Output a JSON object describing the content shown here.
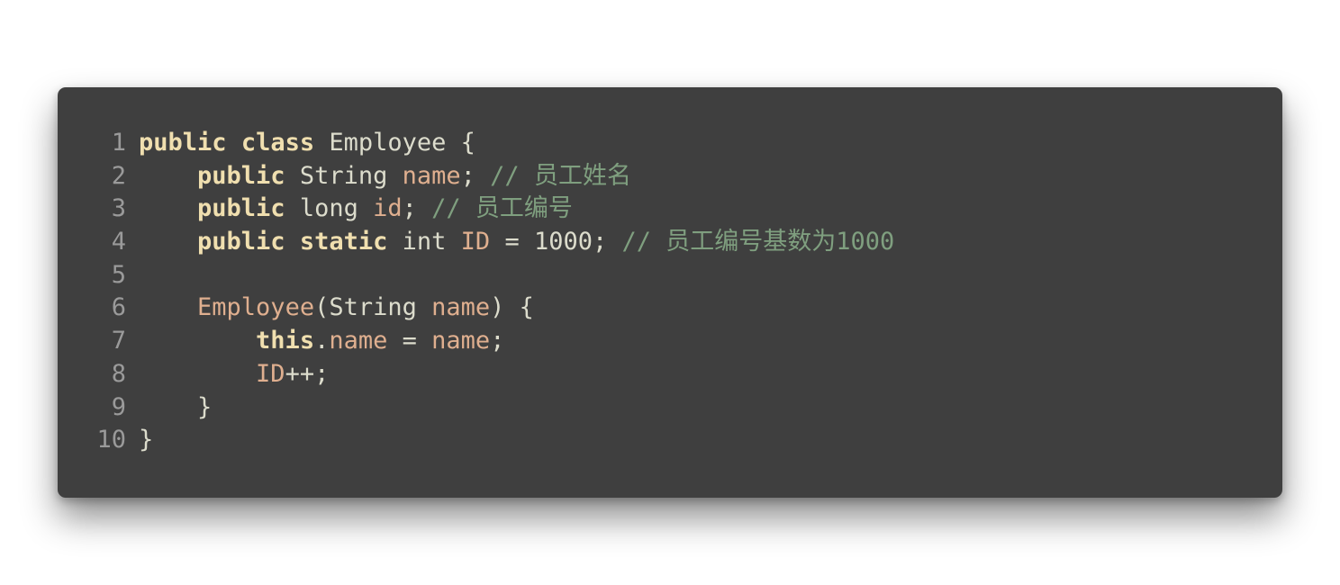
{
  "code": {
    "lines": [
      {
        "num": "1",
        "tokens": [
          {
            "t": "kw",
            "v": "public"
          },
          {
            "t": "pl",
            "v": " "
          },
          {
            "t": "kw",
            "v": "class"
          },
          {
            "t": "pl",
            "v": " Employee {"
          }
        ]
      },
      {
        "num": "2",
        "tokens": [
          {
            "t": "pl",
            "v": "    "
          },
          {
            "t": "kw",
            "v": "public"
          },
          {
            "t": "ty",
            "v": " String "
          },
          {
            "t": "id",
            "v": "name"
          },
          {
            "t": "pl",
            "v": "; "
          },
          {
            "t": "cm",
            "v": "// 员工姓名"
          }
        ]
      },
      {
        "num": "3",
        "tokens": [
          {
            "t": "pl",
            "v": "    "
          },
          {
            "t": "kw",
            "v": "public"
          },
          {
            "t": "ty",
            "v": " long "
          },
          {
            "t": "id",
            "v": "id"
          },
          {
            "t": "pl",
            "v": "; "
          },
          {
            "t": "cm",
            "v": "// 员工编号"
          }
        ]
      },
      {
        "num": "4",
        "tokens": [
          {
            "t": "pl",
            "v": "    "
          },
          {
            "t": "kw",
            "v": "public"
          },
          {
            "t": "pl",
            "v": " "
          },
          {
            "t": "kw",
            "v": "static"
          },
          {
            "t": "ty",
            "v": " int "
          },
          {
            "t": "id",
            "v": "ID"
          },
          {
            "t": "pl",
            "v": " = "
          },
          {
            "t": "num",
            "v": "1000"
          },
          {
            "t": "pl",
            "v": "; "
          },
          {
            "t": "cm",
            "v": "// 员工编号基数为1000"
          }
        ]
      },
      {
        "num": "5",
        "tokens": []
      },
      {
        "num": "6",
        "tokens": [
          {
            "t": "pl",
            "v": "    "
          },
          {
            "t": "fn",
            "v": "Employee"
          },
          {
            "t": "pl",
            "v": "(String "
          },
          {
            "t": "id",
            "v": "name"
          },
          {
            "t": "pl",
            "v": ") {"
          }
        ]
      },
      {
        "num": "7",
        "tokens": [
          {
            "t": "pl",
            "v": "        "
          },
          {
            "t": "kw",
            "v": "this"
          },
          {
            "t": "pl",
            "v": "."
          },
          {
            "t": "id",
            "v": "name"
          },
          {
            "t": "pl",
            "v": " = "
          },
          {
            "t": "id",
            "v": "name"
          },
          {
            "t": "pl",
            "v": ";"
          }
        ]
      },
      {
        "num": "8",
        "tokens": [
          {
            "t": "pl",
            "v": "        "
          },
          {
            "t": "id",
            "v": "ID"
          },
          {
            "t": "pl",
            "v": "++;"
          }
        ]
      },
      {
        "num": "9",
        "tokens": [
          {
            "t": "pl",
            "v": "    }"
          }
        ]
      },
      {
        "num": "10",
        "tokens": [
          {
            "t": "pl",
            "v": "}"
          }
        ]
      }
    ]
  },
  "colors": {
    "background": "#3f3f3f",
    "keyword": "#f0dfaf",
    "identifier": "#dfaf8f",
    "comment": "#7f9f7f",
    "plain": "#dcdccc",
    "line_number": "#9a9a9a"
  }
}
